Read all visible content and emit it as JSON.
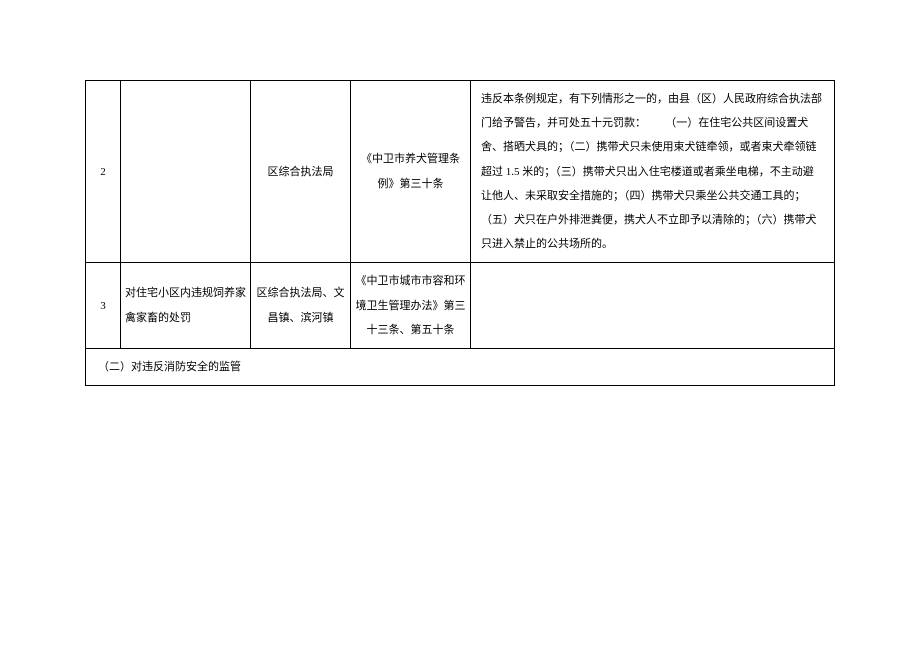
{
  "rows": [
    {
      "num": "2",
      "matter": "",
      "dept": "区综合执法局",
      "basis": "《中卫市养犬管理条例》第三十条",
      "desc": "违反本条例规定，有下列情形之一的，由县（区）人民政府综合执法部门给予警告，并可处五十元罚款：\n　　（一）在住宅公共区间设置犬舍、搭晒犬具的；（二）携带犬只未使用束犬链牵领，或者束犬牵领链超过 1.5 米的；（三）携带犬只出入住宅楼道或者乘坐电梯，不主动避让他人、未采取安全措施的；（四）携带犬只乘坐公共交通工具的；（五）犬只在户外排泄粪便，携犬人不立即予以清除的；（六）携带犬只进入禁止的公共场所的。"
    },
    {
      "num": "3",
      "matter": "对住宅小区内违规饲养家禽家畜的处罚",
      "dept": "区综合执法局、文昌镇、滨河镇",
      "basis": "《中卫市城市市容和环境卫生管理办法》第三十三条、第五十条",
      "desc": ""
    }
  ],
  "section_title": "（二）对违反消防安全的监管"
}
